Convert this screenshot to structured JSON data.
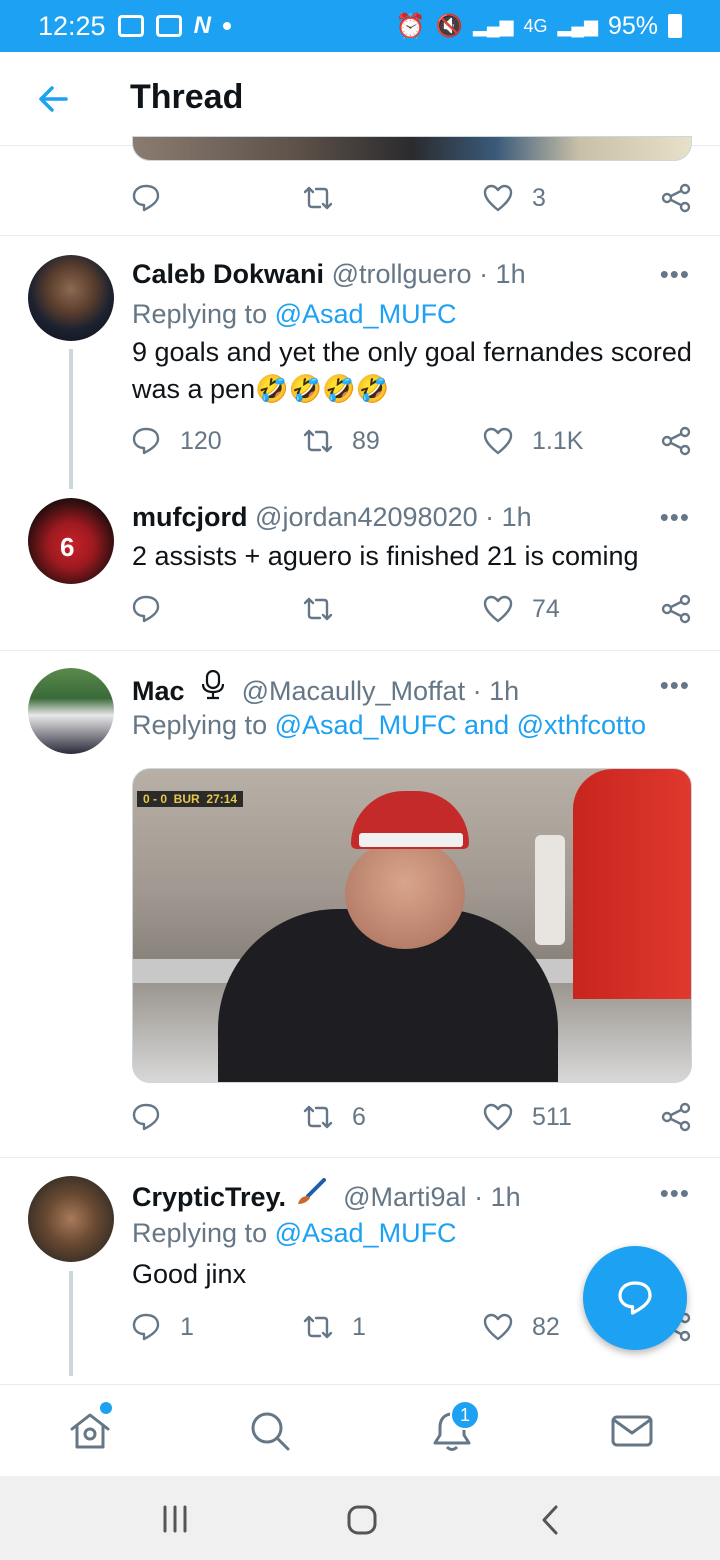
{
  "status_bar": {
    "time": "12:25",
    "signal_label": "4G",
    "battery": "95%"
  },
  "header": {
    "title": "Thread"
  },
  "top_tweet": {
    "likes": "3"
  },
  "tweets": [
    {
      "name": "Caleb Dokwani",
      "handle": "@trollguero",
      "time": "· 1h",
      "reply_prefix": "Replying to",
      "reply_to": "@Asad_MUFC",
      "text": "9 goals and yet the only goal fernandes scored was a pen🤣🤣🤣🤣",
      "replies": "120",
      "retweets": "89",
      "likes": "1.1K"
    },
    {
      "name": "mufcjord",
      "handle": "@jordan42098020",
      "time": "· 1h",
      "text": "2 assists + aguero is finished 21 is coming",
      "replies": "",
      "retweets": "",
      "likes": "74"
    },
    {
      "name": "Mac",
      "name_icon": "microphone-icon",
      "handle": "@Macaully_Moffat",
      "time": "· 1h",
      "reply_prefix": "Replying to",
      "reply_to": "@Asad_MUFC and @xthfcotto",
      "media_scoreboard": "0 - 0  BUR  27:14",
      "replies": "",
      "retweets": "6",
      "likes": "511"
    },
    {
      "name": "CrypticTrey.",
      "name_icon": "paintbrush-icon",
      "handle": "@Marti9al",
      "time": "· 1h",
      "reply_prefix": "Replying to",
      "reply_to": "@Asad_MUFC",
      "text": "Good jinx",
      "replies": "1",
      "retweets": "1",
      "likes": "82"
    }
  ],
  "more_label": "•••",
  "notifications_badge": "1",
  "colors": {
    "accent": "#1da1f2",
    "muted": "#657786",
    "text": "#0f1419"
  }
}
